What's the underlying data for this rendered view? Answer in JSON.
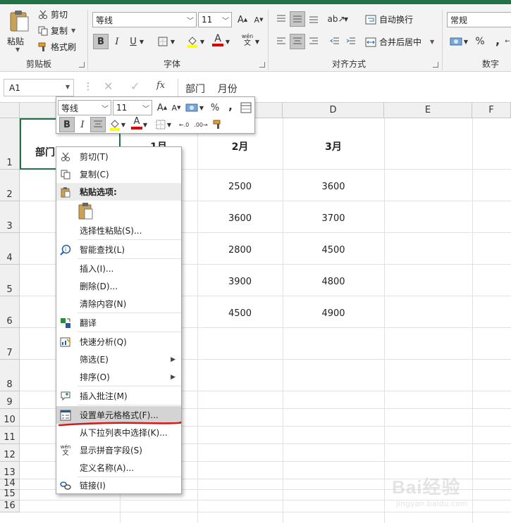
{
  "ribbon": {
    "clipboard": {
      "paste": "粘贴",
      "cut": "剪切",
      "copy": "复制",
      "format_painter": "格式刷",
      "group_label": "剪贴板"
    },
    "font": {
      "font_name": "等线",
      "font_size": "11",
      "bold": "B",
      "italic": "I",
      "underline": "U",
      "font_color_glyph": "A",
      "phonetic_glyph_top": "wén",
      "phonetic_glyph_bottom": "文",
      "group_label": "字体"
    },
    "alignment": {
      "wrap_text": "自动换行",
      "merge_center": "合并后居中",
      "group_label": "对齐方式"
    },
    "number": {
      "format": "常规",
      "percent": "%",
      "comma": ",",
      "group_label": "数字"
    }
  },
  "formula_bar": {
    "name_box": "A1",
    "fx": "fx",
    "content": "部门    月份"
  },
  "grid": {
    "columns": [
      "D",
      "E",
      "F"
    ],
    "rows": [
      "1",
      "2",
      "3",
      "4",
      "5",
      "6",
      "7",
      "8",
      "9",
      "10",
      "11",
      "12",
      "13",
      "14",
      "15",
      "16"
    ],
    "header_cells": {
      "a1": "部门",
      "a1_tail": "月份",
      "b1": "1月",
      "c1": "2月",
      "d1": "3月"
    },
    "c_values": [
      "2500",
      "3600",
      "2800",
      "3900",
      "4500"
    ],
    "d_values": [
      "3600",
      "3700",
      "4500",
      "4800",
      "4900"
    ]
  },
  "mini_toolbar": {
    "font_name": "等线",
    "font_size": "11",
    "percent": "%",
    "comma": ",",
    "bold": "B",
    "italic": "I",
    "font_color_glyph": "A"
  },
  "context_menu": {
    "items": [
      {
        "label": "剪切(T)"
      },
      {
        "label": "复制(C)"
      },
      {
        "label": "粘贴选项:"
      },
      {
        "label": "选择性粘贴(S)..."
      },
      {
        "label": "智能查找(L)"
      },
      {
        "label": "插入(I)..."
      },
      {
        "label": "删除(D)..."
      },
      {
        "label": "清除内容(N)"
      },
      {
        "label": "翻译"
      },
      {
        "label": "快速分析(Q)"
      },
      {
        "label": "筛选(E)"
      },
      {
        "label": "排序(O)"
      },
      {
        "label": "插入批注(M)"
      },
      {
        "label": "设置单元格格式(F)..."
      },
      {
        "label": "从下拉列表中选择(K)..."
      },
      {
        "label": "显示拼音字段(S)"
      },
      {
        "label": "定义名称(A)..."
      },
      {
        "label": "链接(I)"
      }
    ],
    "phonetic_icon_top": "wén",
    "phonetic_icon_bottom": "文"
  },
  "watermark": {
    "brand": "Bai经验",
    "url": "jingyan.baidu.com"
  },
  "colors": {
    "excel_green": "#217346",
    "annotation_red": "#d11a1a",
    "highlight": "#d4d4d4"
  }
}
